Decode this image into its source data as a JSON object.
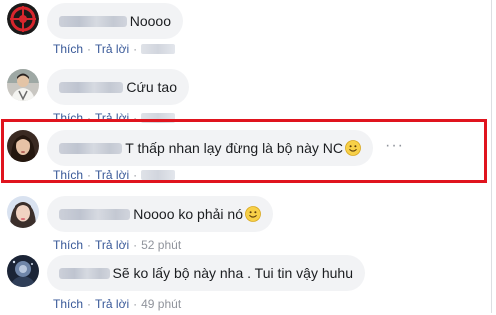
{
  "actions": {
    "like_label": "Thích",
    "reply_label": "Trả lời",
    "separator": "·"
  },
  "comments": [
    {
      "text": "Noooo",
      "timestamp": ""
    },
    {
      "text": "Cứu tao",
      "timestamp": ""
    },
    {
      "text": "T thấp nhan lạy đừng là bộ này NC",
      "timestamp": "",
      "emoji": "smiley-emoji",
      "more": "···"
    },
    {
      "text": "Noooo ko phải nó",
      "timestamp": "52 phút",
      "emoji": "smiley-emoji"
    },
    {
      "text": "Sẽ ko lấy bộ này nha . Tui tin vậy huhu",
      "timestamp": "49 phút"
    }
  ],
  "colors": {
    "highlight": "#e0141e",
    "link": "#385898",
    "bubble": "#f2f3f5",
    "meta": "#90949c"
  }
}
